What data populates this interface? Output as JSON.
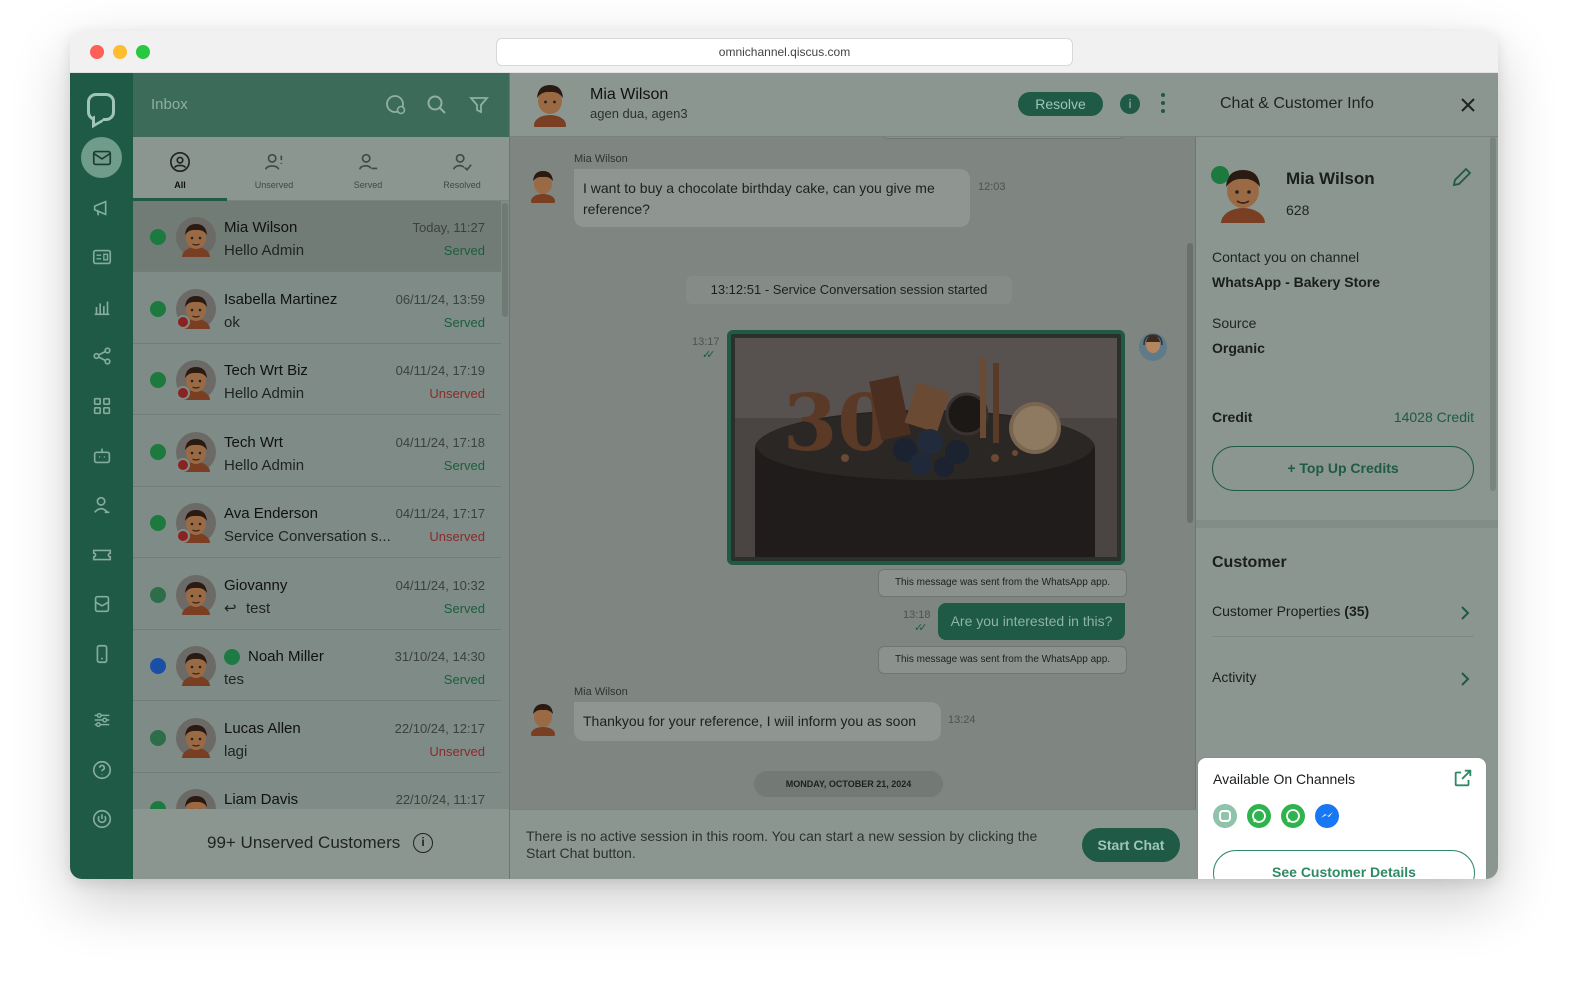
{
  "browser": {
    "url": "omnichannel.qiscus.com"
  },
  "rail": {
    "items": [
      "inbox-icon",
      "broadcast-icon",
      "contacts-icon",
      "analytics-icon",
      "integration-icon",
      "apps-icon",
      "bot-icon",
      "agent-icon",
      "ticket-icon",
      "mail-icon",
      "mobile-icon",
      "settings-icon",
      "help-icon",
      "power-icon"
    ]
  },
  "inbox": {
    "title": "Inbox",
    "tabs": [
      {
        "label": "All"
      },
      {
        "label": "Unserved"
      },
      {
        "label": "Served"
      },
      {
        "label": "Resolved"
      }
    ],
    "conversations": [
      {
        "name": "Mia Wilson",
        "message": "Hello Admin",
        "time": "Today, 11:27",
        "status": "Served",
        "channel": "whatsapp"
      },
      {
        "name": "Isabella Martinez",
        "message": "ok",
        "time": "06/11/24, 13:59",
        "status": "Served",
        "channel": "whatsapp"
      },
      {
        "name": "Tech Wrt Biz",
        "message": "Hello Admin",
        "time": "04/11/24, 17:19",
        "status": "Unserved",
        "channel": "whatsapp"
      },
      {
        "name": "Tech Wrt",
        "message": "Hello Admin",
        "time": "04/11/24, 17:18",
        "status": "Served",
        "channel": "whatsapp"
      },
      {
        "name": "Ava Enderson",
        "message": "Service Conversation s...",
        "time": "04/11/24, 17:17",
        "status": "Unserved",
        "channel": "whatsapp"
      },
      {
        "name": "Giovanny",
        "message": "test",
        "time": "04/11/24, 10:32",
        "status": "Served",
        "channel": "agent"
      },
      {
        "name": "Noah Miller",
        "message": "tes",
        "time": "31/10/24, 14:30",
        "status": "Served",
        "channel": "messenger"
      },
      {
        "name": "Lucas Allen",
        "message": "lagi",
        "time": "22/10/24, 12:17",
        "status": "Unserved",
        "channel": "qiscus"
      },
      {
        "name": "Liam Davis",
        "message": "",
        "time": "22/10/24, 11:17",
        "status": "",
        "channel": "whatsapp"
      }
    ],
    "footer": "99+ Unserved Customers"
  },
  "chat": {
    "name": "Mia Wilson",
    "agents": "agen dua, agen3",
    "resolve_label": "Resolve",
    "messages": {
      "m1_sender": "Mia Wilson",
      "m1_text": "I want to buy a chocolate birthday cake, can you give me reference?",
      "m1_time": "12:03",
      "session": "13:12:51 - Service Conversation session started",
      "img_time": "13:17",
      "wa_note": "This message was sent from the WhatsApp app.",
      "out_text": "Are you interested in this?",
      "out_time": "13:18",
      "m2_sender": "Mia Wilson",
      "m2_text": "Thankyou for your reference, I wiil inform you as soon",
      "m2_time": "13:24",
      "date_divider": "MONDAY, OCTOBER 21, 2024"
    },
    "footer_text": "There is no active session in this room. You can start a new session by clicking the Start Chat button.",
    "start_chat_label": "Start Chat"
  },
  "info": {
    "title": "Chat & Customer Info",
    "name": "Mia Wilson",
    "id": "628",
    "channel_label": "Contact you on channel",
    "channel_value": "WhatsApp - Bakery Store",
    "source_label": "Source",
    "source_value": "Organic",
    "credit_label": "Credit",
    "credit_value": "14028 Credit",
    "topup_label": "+ Top Up Credits",
    "customer_title": "Customer",
    "properties_label": "Customer Properties",
    "properties_count": "(35)",
    "activity_label": "Activity",
    "available_title": "Available On Channels",
    "see_details_label": "See Customer Details",
    "channels": [
      "qiscus-icon",
      "whatsapp-icon",
      "whatsapp-icon",
      "messenger-icon"
    ]
  },
  "colors": {
    "brand": "#1e5a45",
    "accent": "#2e8a64",
    "overlay_dim": "#7f8b86"
  }
}
